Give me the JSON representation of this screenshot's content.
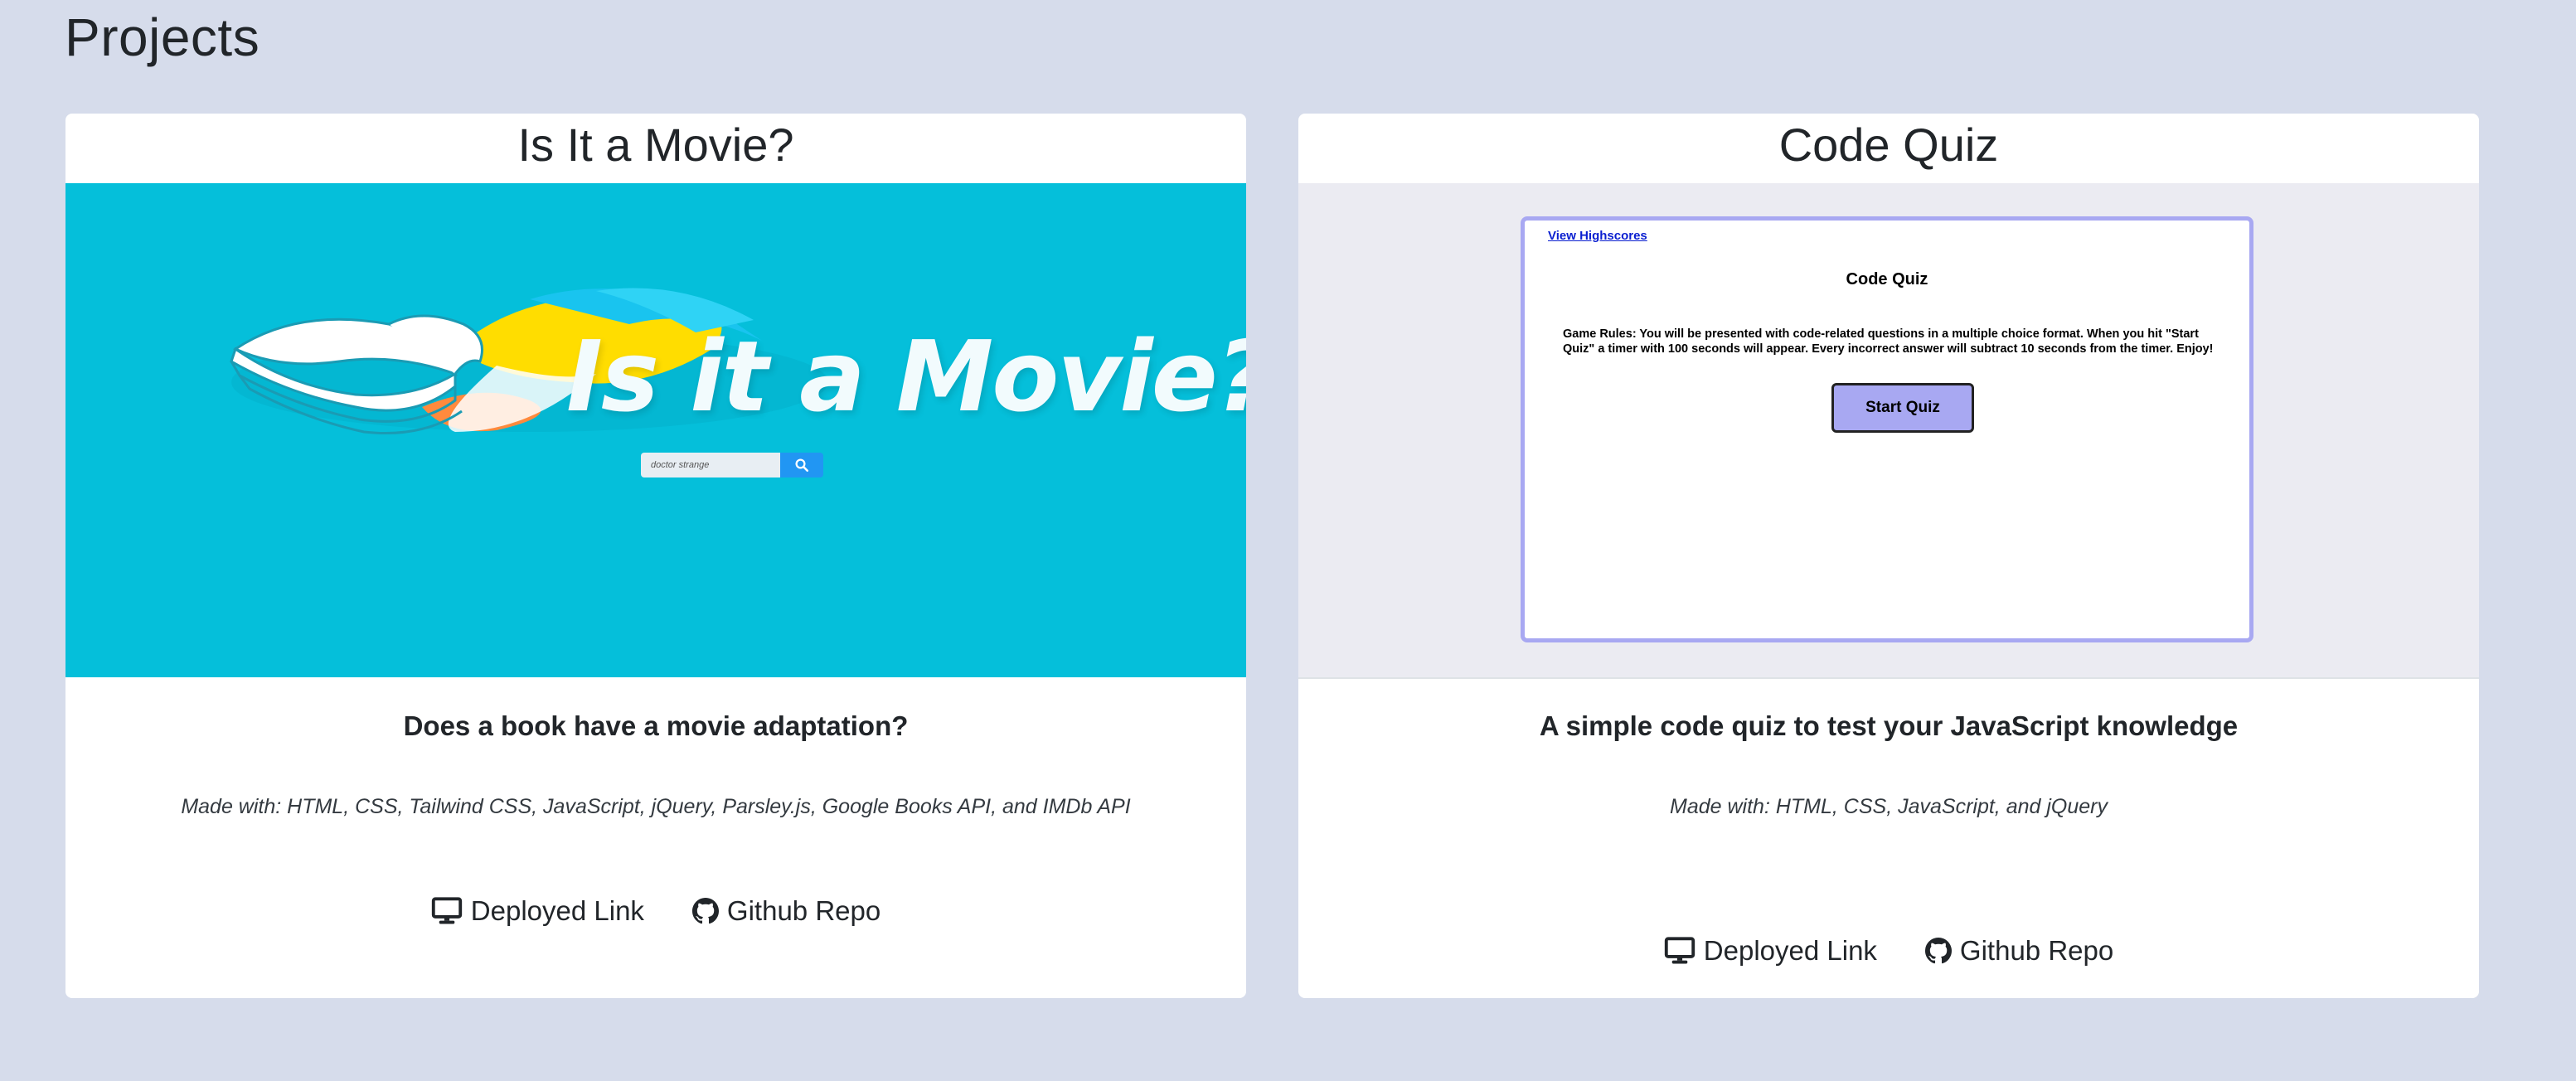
{
  "page": {
    "title": "Projects",
    "background_color": "#d6dceb"
  },
  "projects": [
    {
      "title": "Is It a Movie?",
      "description": "Does a book have a movie adaptation?",
      "made_with": "Made with: HTML, CSS, Tailwind CSS, JavaScript, jQuery, Parsley.js, Google Books API, and IMDb API",
      "deployed_label": "Deployed Link",
      "repo_label": "Github Repo",
      "screenshot": {
        "logo_text": "Is it a Movie?",
        "search_value": "doctor strange",
        "background_color": "#05bfda"
      }
    },
    {
      "title": "Code Quiz",
      "description": "A simple code quiz to test your JavaScript knowledge",
      "made_with": "Made with: HTML, CSS, JavaScript, and jQuery",
      "deployed_label": "Deployed Link",
      "repo_label": "Github Repo",
      "screenshot": {
        "highscores_link": "View Highscores",
        "quiz_title": "Code Quiz",
        "rules": "Game Rules: You will be presented with code-related questions in a multiple choice format. When you hit \"Start Quiz\" a timer with 100 seconds will appear. Every incorrect answer will subtract 10 seconds from the timer. Enjoy!",
        "start_button": "Start Quiz",
        "accent_color": "#a8a8f2"
      }
    }
  ],
  "icons": {
    "deployed": "monitor-icon",
    "repo": "github-icon",
    "search": "search-icon"
  }
}
